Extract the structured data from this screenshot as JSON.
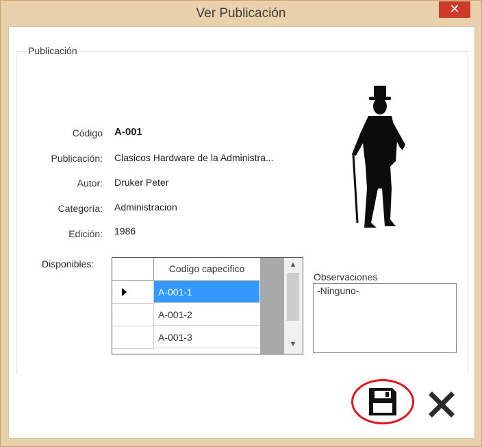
{
  "window": {
    "title": "Ver Publicación",
    "close_glyph": "✕"
  },
  "group": {
    "legend": "Publicación"
  },
  "fields": [
    {
      "label": "Código",
      "value": "A-001"
    },
    {
      "label": "Publicación:",
      "value": "Clasicos Hardware de la Administra..."
    },
    {
      "label": "Autor:",
      "value": "Druker Peter"
    },
    {
      "label": "Categoría:",
      "value": "Administracion"
    },
    {
      "label": "Edición:",
      "value": "1986"
    }
  ],
  "disponibles": {
    "label": "Disponibles:",
    "column_header": "Codigo capecifico",
    "rows": [
      "A-001-1",
      "A-001-2",
      "A-001-3"
    ],
    "selected_row": 0
  },
  "observaciones": {
    "label": "Observaciones",
    "value": "-Ninguno-"
  },
  "icons": {
    "save": "floppy-disk-icon",
    "cancel": "x-icon",
    "image": "man-with-cane-silhouette"
  },
  "colors": {
    "selection": "#3399ff",
    "close": "#cc3a2a",
    "highlight_circle": "#e0141a"
  }
}
